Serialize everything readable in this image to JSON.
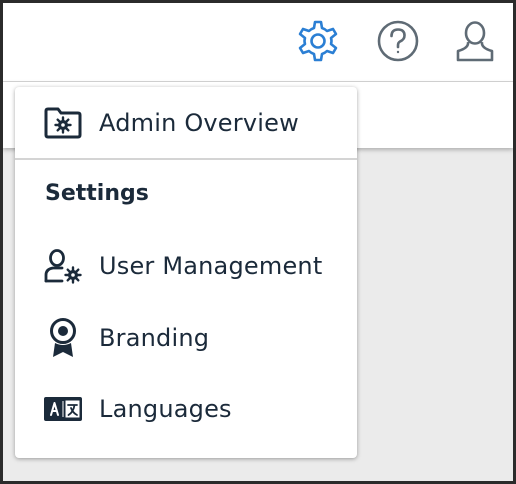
{
  "colors": {
    "accent": "#2b7fd4",
    "icon_gray": "#5f6b75",
    "text_dark": "#1b2a3a",
    "background_gray": "#ebebeb"
  },
  "header": {
    "icons": [
      {
        "name": "settings-gear-icon",
        "active": true
      },
      {
        "name": "help-question-icon",
        "active": false
      },
      {
        "name": "user-profile-icon",
        "active": false
      }
    ]
  },
  "menu": {
    "top_item": {
      "label": "Admin Overview",
      "icon": "folder-gear-icon"
    },
    "section_heading": "Settings",
    "items": [
      {
        "label": "User Management",
        "icon": "user-gear-icon"
      },
      {
        "label": "Branding",
        "icon": "award-ribbon-icon"
      },
      {
        "label": "Languages",
        "icon": "translate-icon"
      }
    ]
  }
}
